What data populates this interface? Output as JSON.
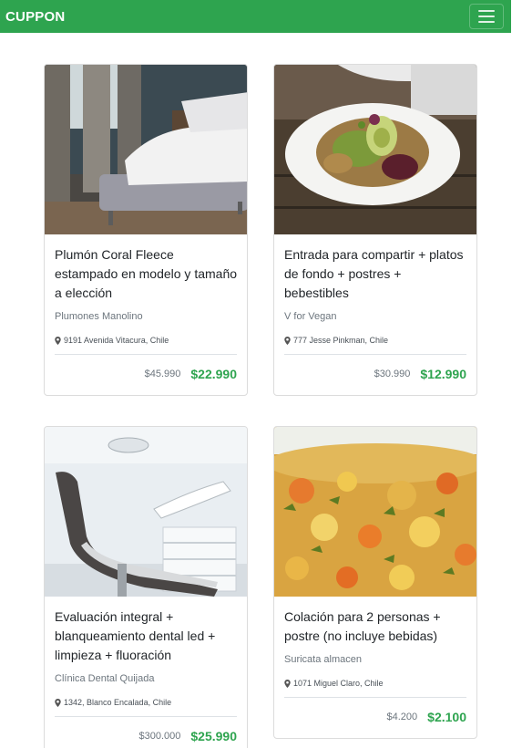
{
  "navbar": {
    "brand": "CUPPON"
  },
  "deals": [
    {
      "title": "Plumón Coral Fleece estampado en modelo y tamaño a elección",
      "vendor": "Plumones Manolino",
      "address": "9191 Avenida Vitacura, Chile",
      "old_price": "$45.990",
      "new_price": "$22.990",
      "image_icon": "bedroom-photo"
    },
    {
      "title": "Entrada para compartir + platos de fondo + postres + bebestibles",
      "vendor": "V for Vegan",
      "address": "777 Jesse Pinkman, Chile",
      "old_price": "$30.990",
      "new_price": "$12.990",
      "image_icon": "salad-bowl-photo"
    },
    {
      "title": "Evaluación integral + blanqueamiento dental led + limpieza + fluoración",
      "vendor": "Clínica Dental Quijada",
      "address": "1342, Blanco Encalada, Chile",
      "old_price": "$300.000",
      "new_price": "$25.990",
      "image_icon": "dental-chair-photo"
    },
    {
      "title": "Colación para 2 personas + postre (no incluye bebidas)",
      "vendor": "Suricata almacen",
      "address": "1071 Miguel Claro, Chile",
      "old_price": "$4.200",
      "new_price": "$2.100",
      "image_icon": "vegetable-dish-photo"
    }
  ],
  "colors": {
    "brand": "#2ea44f",
    "price": "#2ea44f"
  }
}
